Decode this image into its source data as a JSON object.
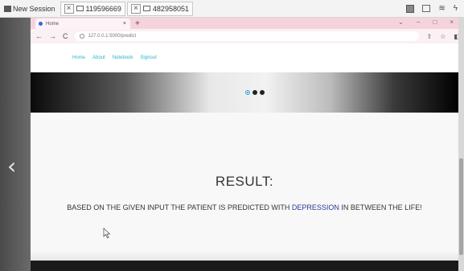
{
  "session": {
    "tabs": [
      {
        "label": "New Session"
      },
      {
        "label": "119596669"
      },
      {
        "label": "482958051"
      }
    ]
  },
  "browser": {
    "tab_title": "Home",
    "tab_close": "×",
    "new_tab": "+",
    "url": "127.0.0.1:5000/predict",
    "controls": {
      "minimize": "−",
      "maximize": "□",
      "close": "×",
      "dropdown": "⌄"
    }
  },
  "site": {
    "nav": [
      "Home",
      "About",
      "Notebook",
      "Signout"
    ]
  },
  "banner": {
    "carousel_slides": 3,
    "active_slide": 1
  },
  "result": {
    "title": "RESULT:",
    "text_before": "BASED ON THE GIVEN INPUT THE PATIENT IS PREDICTED WITH ",
    "condition": "DEPRESSION",
    "text_after": " IN BETWEEN THE LIFE!"
  },
  "back_to_top": "^",
  "colors": {
    "nav_link": "#2ab6c8",
    "condition": "#2a3a9a",
    "tabstrip": "#f6d3dc"
  }
}
